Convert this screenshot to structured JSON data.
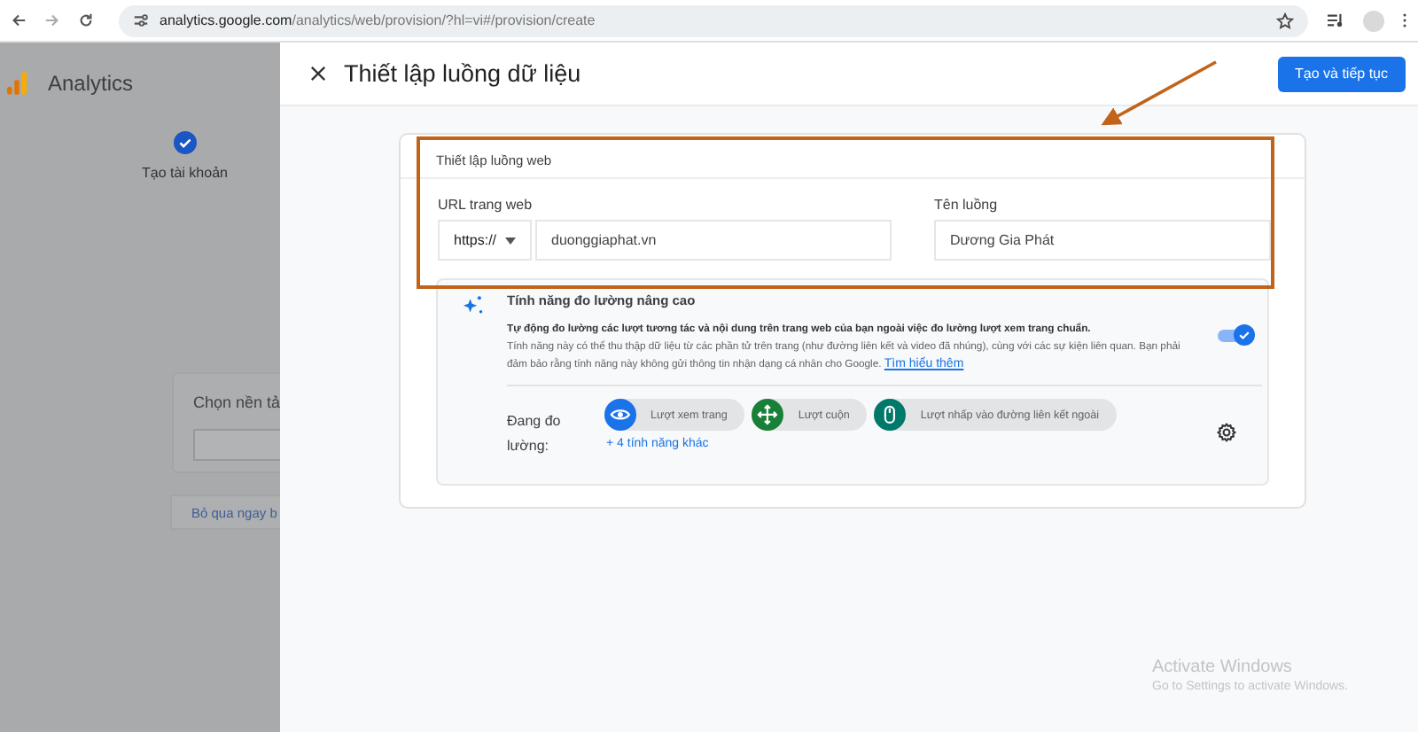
{
  "browser": {
    "url_host": "analytics.google.com",
    "url_path": "/analytics/web/provision/?hl=vi#/provision/create"
  },
  "app": {
    "name": "Analytics"
  },
  "steps": [
    {
      "label": "Tạo tài khoản",
      "completed": true
    }
  ],
  "background_card": {
    "title": "Chọn nền tả"
  },
  "background_link": "Bỏ qua ngay b",
  "dialog": {
    "title": "Thiết lập luồng dữ liệu",
    "primary_button": "Tạo và tiếp tục"
  },
  "stream_card": {
    "title": "Thiết lập luồng web",
    "url_label": "URL trang web",
    "protocol": "https://",
    "url_value": "duonggiaphat.vn",
    "name_label": "Tên luồng",
    "name_value": "Dương Gia Phát"
  },
  "enhanced": {
    "title": "Tính năng đo lường nâng cao",
    "lead": "Tự động đo lường các lượt tương tác và nội dung trên trang web của bạn ngoài việc đo lường lượt xem trang chuẩn.",
    "description": "Tính năng này có thể thu thập dữ liệu từ các phần tử trên trang (như đường liên kết và video đã nhúng), cùng với các sự kiện liên quan. Bạn phải đảm bảo rằng tính năng này không gửi thông tin nhận dạng cá nhân cho Google.",
    "link": "Tìm hiểu thêm",
    "on": true,
    "measuring_label": "Đang đo lường:",
    "chips": [
      {
        "label": "Lượt xem trang",
        "kind": "eye",
        "color": "#1a73e8"
      },
      {
        "label": "Lượt cuộn",
        "kind": "move",
        "color": "#188038"
      },
      {
        "label": "Lượt nhấp vào đường liên kết ngoài",
        "kind": "mouse",
        "color": "#00796b"
      }
    ],
    "more": "+ 4 tính năng khác"
  },
  "os_notice": {
    "title": "Activate Windows",
    "subtitle": "Go to Settings to activate Windows."
  }
}
